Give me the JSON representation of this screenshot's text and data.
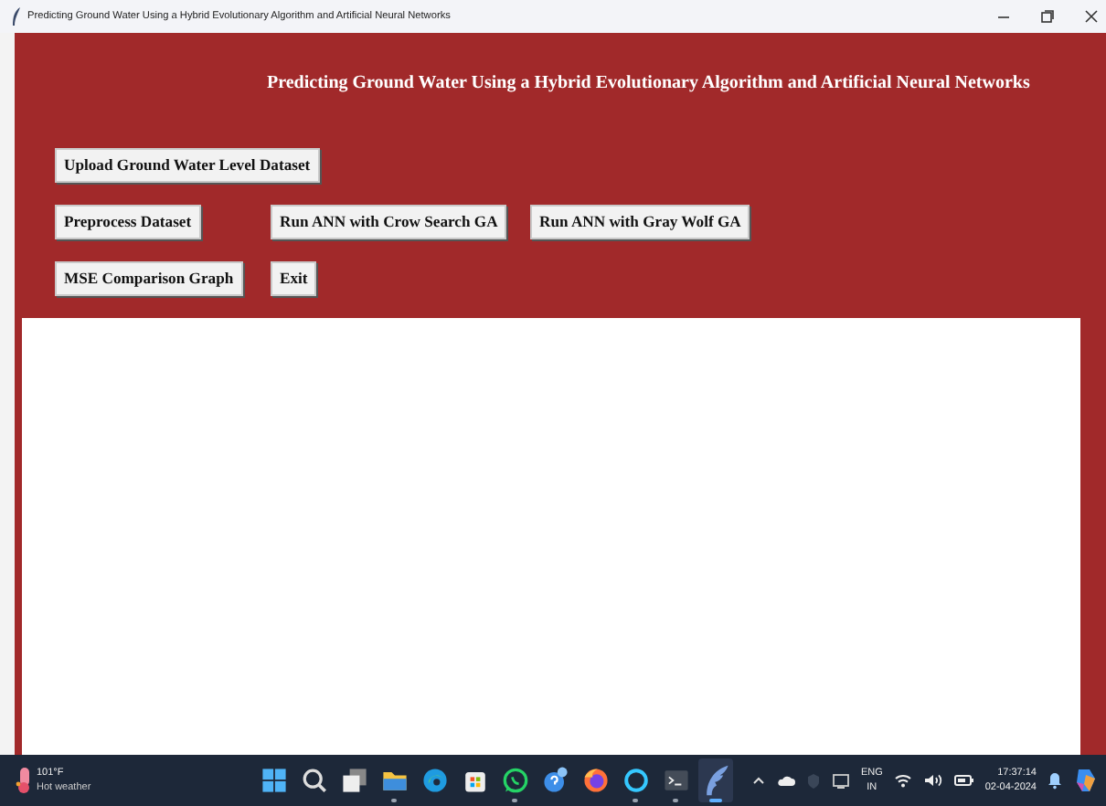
{
  "window": {
    "title": "Predicting Ground Water Using a Hybrid Evolutionary Algorithm and Artificial Neural Networks"
  },
  "heading": "Predicting Ground Water Using a Hybrid Evolutionary Algorithm and Artificial Neural Networks",
  "button_rows": [
    [
      "Upload Ground Water Level Dataset"
    ],
    [
      "Preprocess Dataset",
      "Run ANN with Crow Search GA",
      "Run ANN with Gray Wolf GA"
    ],
    [
      "MSE Comparison Graph",
      "Exit"
    ]
  ],
  "taskbar": {
    "weather": {
      "temperature": "101°F",
      "condition": "Hot weather"
    },
    "apps": [
      {
        "kind": "start",
        "running": false,
        "active": false
      },
      {
        "kind": "search",
        "running": false,
        "active": false
      },
      {
        "kind": "taskview",
        "running": false,
        "active": false
      },
      {
        "kind": "folder",
        "running": true,
        "active": false
      },
      {
        "kind": "edge",
        "running": false,
        "active": false
      },
      {
        "kind": "store",
        "running": false,
        "active": false
      },
      {
        "kind": "chat",
        "running": true,
        "active": false
      },
      {
        "kind": "help",
        "running": false,
        "active": false
      },
      {
        "kind": "firefox",
        "running": false,
        "active": false
      },
      {
        "kind": "ring",
        "running": true,
        "active": false
      },
      {
        "kind": "terminal",
        "running": true,
        "active": false
      },
      {
        "kind": "feather",
        "running": true,
        "active": true
      }
    ],
    "language": [
      "ENG",
      "IN"
    ],
    "time": "17:37:14",
    "date": "02-04-2024"
  }
}
